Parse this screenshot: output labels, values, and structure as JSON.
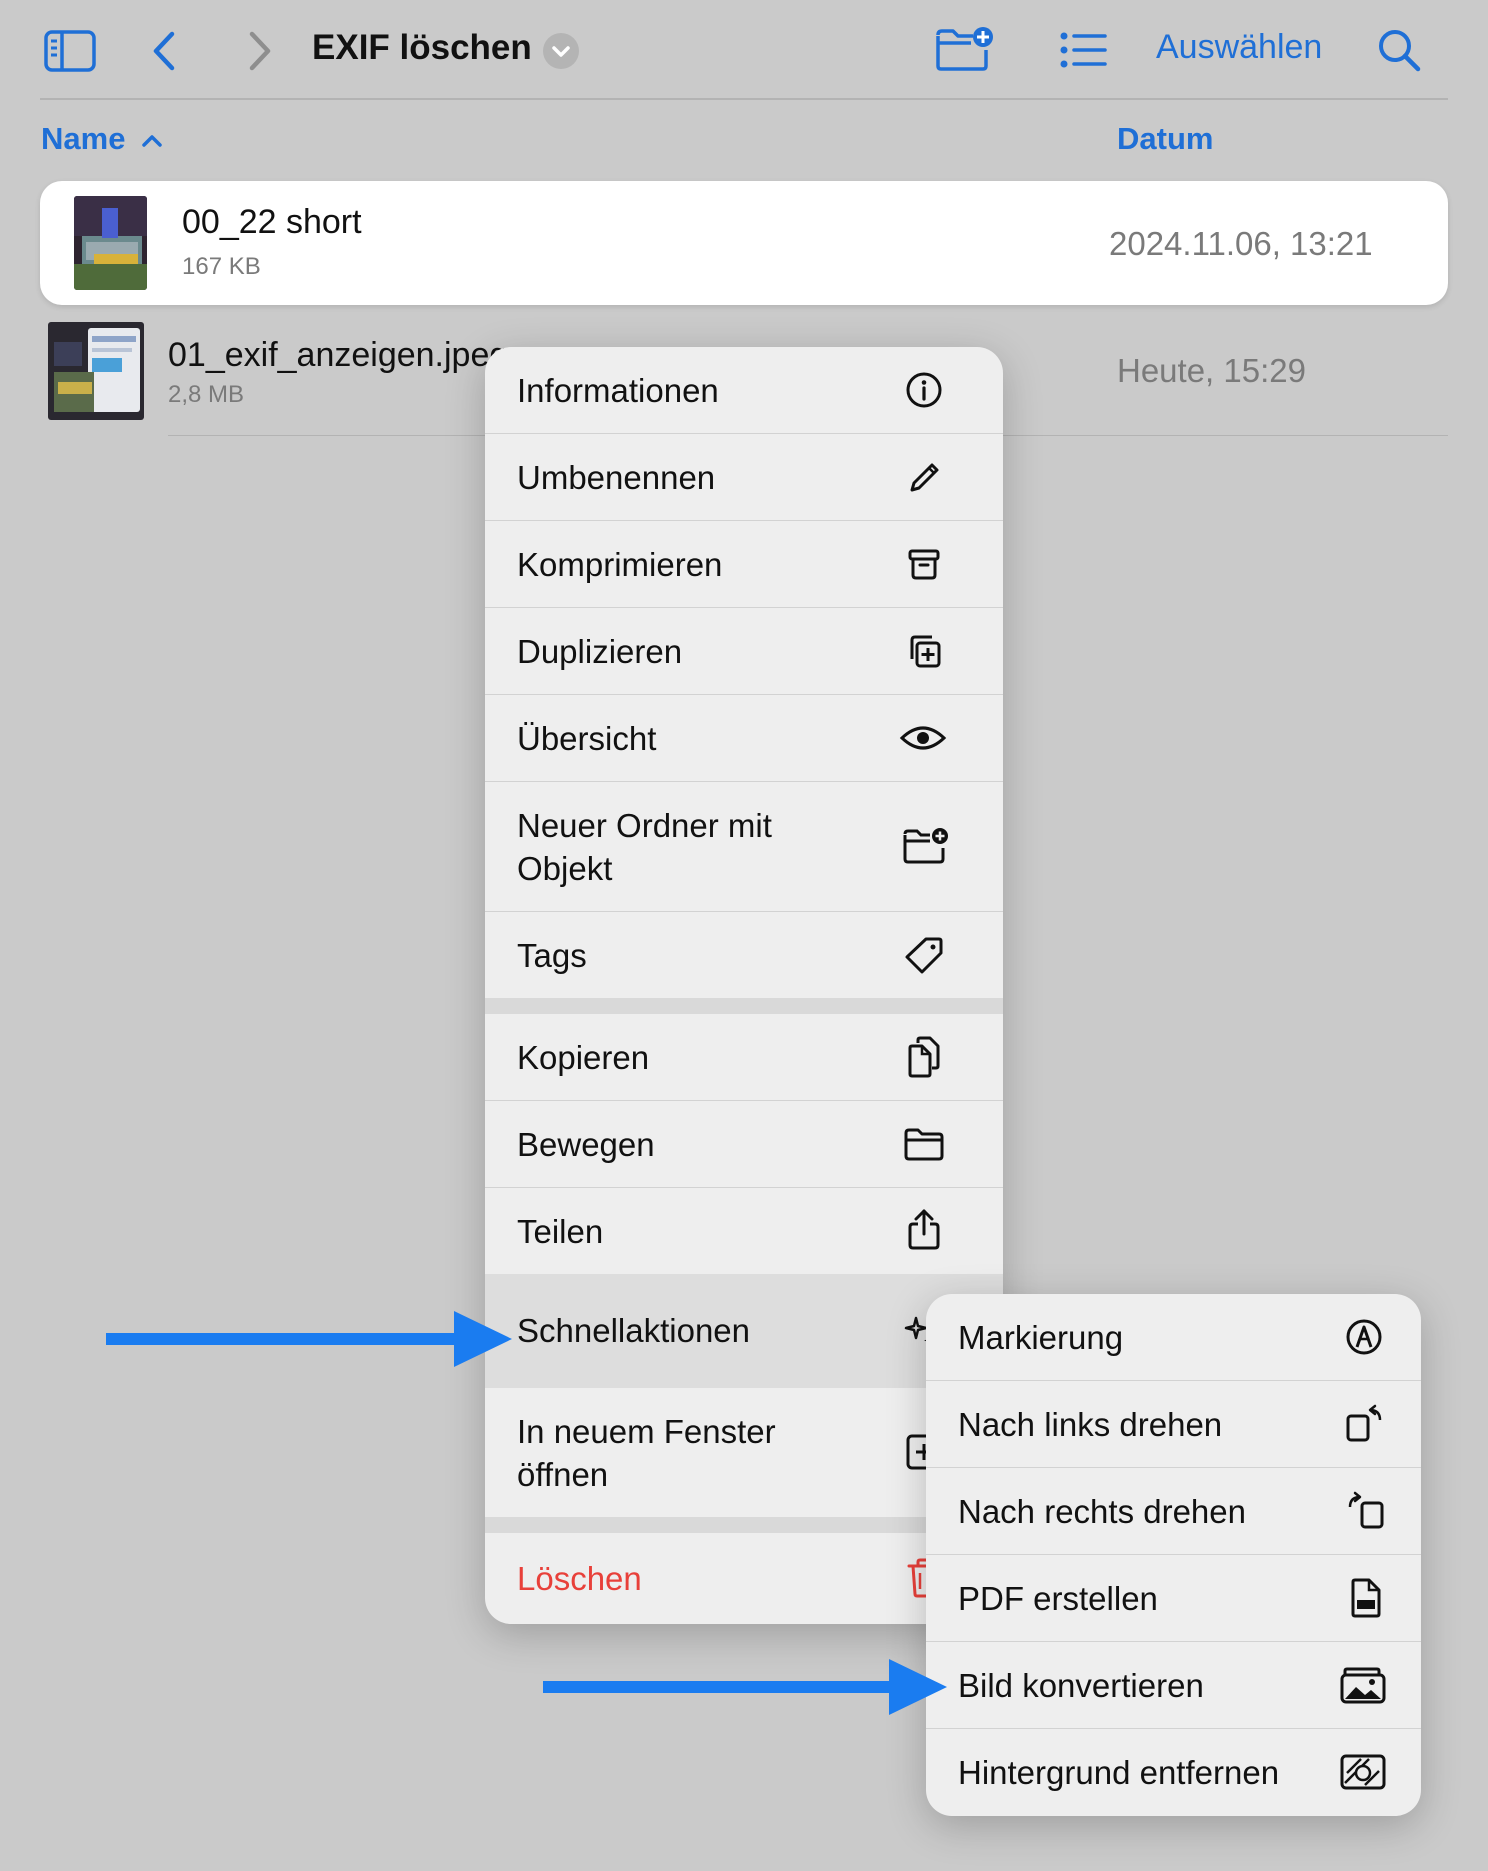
{
  "toolbar": {
    "title": "EXIF löschen",
    "select_label": "Auswählen",
    "icons": [
      "sidebar-icon",
      "back-chevron-icon",
      "forward-chevron-icon",
      "chevron-down-icon",
      "new-folder-icon",
      "list-view-icon",
      "search-icon"
    ]
  },
  "columns": {
    "name": "Name",
    "date": "Datum",
    "sort": "ascending"
  },
  "files": [
    {
      "name": "00_22 short",
      "size": "167 KB",
      "date": "2024.11.06, 13:21",
      "selected": true
    },
    {
      "name": "01_exif_anzeigen.jpeg",
      "size": "2,8 MB",
      "date": "Heute, 15:29",
      "selected": false
    }
  ],
  "context_menu": {
    "groups": [
      [
        {
          "label": "Informationen",
          "icon": "info-icon"
        },
        {
          "label": "Umbenennen",
          "icon": "pencil-icon"
        },
        {
          "label": "Komprimieren",
          "icon": "archive-icon"
        },
        {
          "label": "Duplizieren",
          "icon": "duplicate-icon"
        },
        {
          "label": "Übersicht",
          "icon": "eye-icon"
        },
        {
          "label_line1": "Neuer Ordner mit",
          "label_line2": "Objekt",
          "icon": "folder-plus-icon"
        },
        {
          "label": "Tags",
          "icon": "tag-icon"
        }
      ],
      [
        {
          "label": "Kopieren",
          "icon": "copy-icon"
        },
        {
          "label": "Bewegen",
          "icon": "folder-icon"
        },
        {
          "label": "Teilen",
          "icon": "share-icon"
        },
        {
          "label": "Schnellaktionen",
          "icon": "sparkles-icon",
          "highlighted": true
        },
        {
          "label_line1": "In neuem Fenster",
          "label_line2": "öffnen",
          "icon": "new-window-icon"
        }
      ],
      [
        {
          "label": "Löschen",
          "icon": "trash-icon",
          "destructive": true
        }
      ]
    ]
  },
  "submenu": {
    "items": [
      {
        "label": "Markierung",
        "icon": "markup-icon"
      },
      {
        "label": "Nach links drehen",
        "icon": "rotate-left-icon"
      },
      {
        "label": "Nach rechts drehen",
        "icon": "rotate-right-icon"
      },
      {
        "label": "PDF erstellen",
        "icon": "pdf-icon"
      },
      {
        "label": "Bild konvertieren",
        "icon": "convert-image-icon"
      },
      {
        "label": "Hintergrund entfernen",
        "icon": "remove-background-icon"
      }
    ]
  },
  "annotations": {
    "arrow_color": "#1a7cf0",
    "arrows": [
      "schnellaktionen",
      "bild-konvertieren"
    ]
  },
  "colors": {
    "accent": "#1f6fd6",
    "destructive": "#e8403a",
    "background": "#cacaca",
    "menu": "#eeeeee"
  }
}
